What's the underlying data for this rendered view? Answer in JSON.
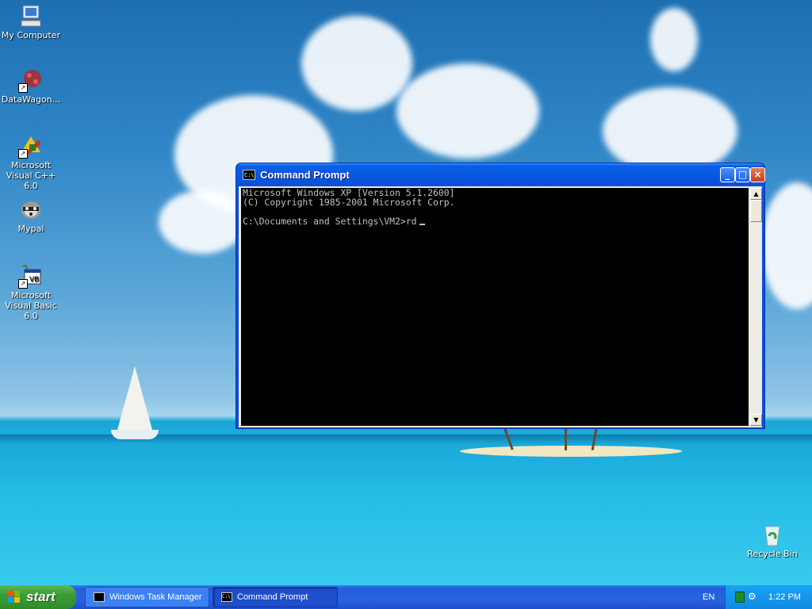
{
  "desktop": {
    "icons": [
      {
        "label": "My Computer"
      },
      {
        "label": "DataWagon..."
      },
      {
        "label": "Microsoft Visual C++ 6.0"
      },
      {
        "label": "Mypal"
      },
      {
        "label": "Microsoft Visual Basic 6.0"
      },
      {
        "label": "Recycle Bin"
      }
    ]
  },
  "window": {
    "title": "Command Prompt",
    "icon_text": "C:\\",
    "buttons": {
      "minimize": "_",
      "maximize": "□",
      "close": "×"
    },
    "console_lines": [
      "Microsoft Windows XP [Version 5.1.2600]",
      "(C) Copyright 1985-2001 Microsoft Corp.",
      "",
      "C:\\Documents and Settings\\VM2>rd"
    ]
  },
  "taskbar": {
    "start_label": "start",
    "tasks": [
      {
        "label": "Windows Task Manager",
        "active": false
      },
      {
        "label": "Command Prompt",
        "active": true
      }
    ],
    "language": "EN",
    "clock": "1:22 PM"
  }
}
